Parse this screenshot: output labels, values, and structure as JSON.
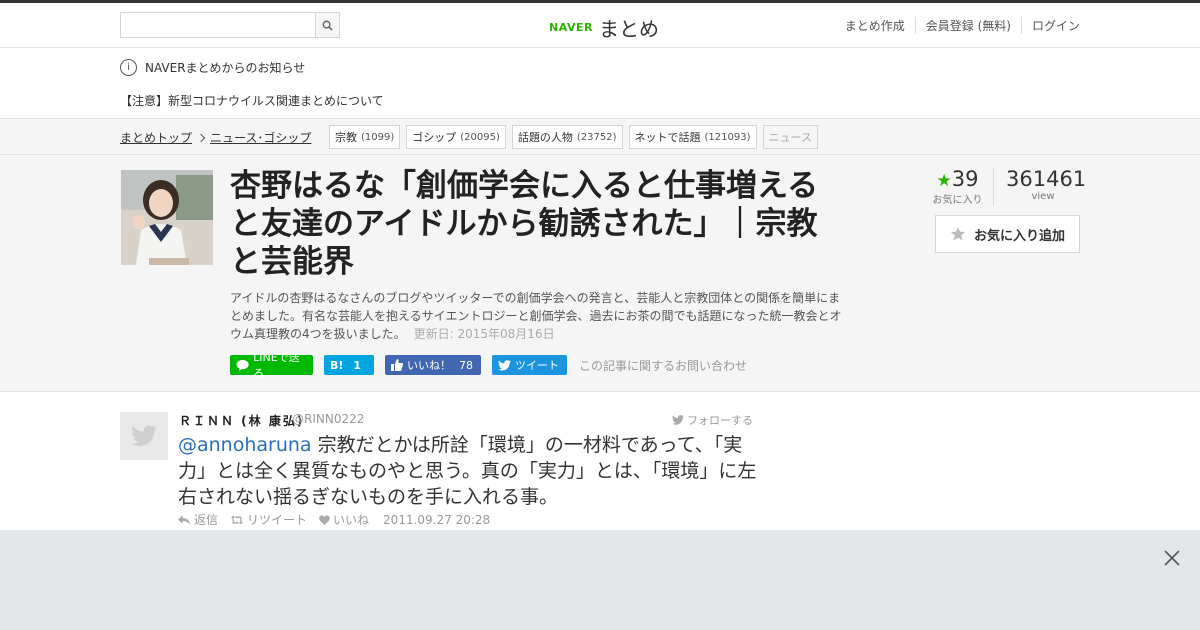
{
  "header": {
    "search_placeholder": "",
    "logo_brand": "NAVER",
    "logo_text": "まとめ",
    "nav": [
      "まとめ作成",
      "会員登録 (無料)",
      "ログイン"
    ]
  },
  "notice": {
    "heading": "NAVERまとめからのお知らせ",
    "link": "【注意】新型コロナウイルス関連まとめについて"
  },
  "breadcrumb": {
    "items": [
      "まとめトップ",
      "ニュース･ゴシップ"
    ]
  },
  "tags": [
    {
      "label": "宗教",
      "count": "(1099)"
    },
    {
      "label": "ゴシップ",
      "count": "(20095)"
    },
    {
      "label": "話題の人物",
      "count": "(23752)"
    },
    {
      "label": "ネットで話題",
      "count": "(121093)"
    },
    {
      "label": "ニュース",
      "count": ""
    }
  ],
  "article": {
    "title": "杏野はるな「創価学会に入ると仕事増えると友達のアイドルから勧誘された」｜宗教と芸能界",
    "description": "アイドルの杏野はるなさんのブログやツイッターでの創価学会への発言と、芸能人と宗教団体との関係を簡単にまとめました。有名な芸能人を抱えるサイエントロジーと創価学会、過去にお茶の間でも話題になった統一教会とオウム真理教の4つを扱いました。",
    "updated": "更新日: 2015年08月16日",
    "favorites_count": "39",
    "favorites_label": "お気に入り",
    "views_count": "361461",
    "views_label": "view",
    "fav_button": "お気に入り追加"
  },
  "share": {
    "line": "LINEで送る",
    "hatena_count": "1",
    "fb_label": "いいね！",
    "fb_count": "78",
    "tweet": "ツイート",
    "contact": "この記事に関するお問い合わせ"
  },
  "tweet": {
    "name": "ＲＩＮＮ (林 康弘)",
    "handle": "@RINN0222",
    "follow": "フォローする",
    "mention": "@annoharuna",
    "text": " 宗教だとかは所詮「環境」の一材料であって、「実力」とは全く異質なものやと思う。真の「実力」とは、「環境」に左右されない揺るぎないものを手に入れる事。",
    "reply": "返信",
    "retweet": "リツイート",
    "like": "いいね",
    "timestamp": "2011.09.27 20:28"
  },
  "colors": {
    "naver_green": "#2db400",
    "line_green": "#00b900",
    "hatena_blue": "#00a4de",
    "facebook_blue": "#4267b2",
    "twitter_blue": "#1b95e0",
    "mention_blue": "#2a6fbb"
  }
}
